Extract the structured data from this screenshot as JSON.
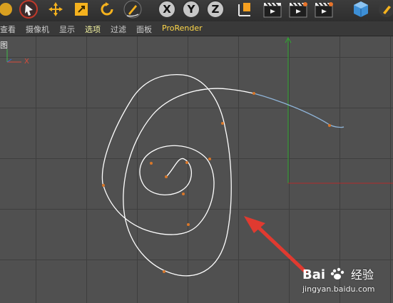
{
  "toolbar": {
    "axis_x_label": "X",
    "axis_y_label": "Y",
    "axis_z_label": "Z"
  },
  "menubar": {
    "items": [
      "查看",
      "摄像机",
      "显示",
      "选项",
      "过滤",
      "面板",
      "ProRender"
    ],
    "active_index": 3
  },
  "viewport": {
    "view_name": "图",
    "axis_label": "X"
  },
  "watermark": {
    "logo": "Bai",
    "logo_tail": "经验",
    "url": "jingyan.baidu.com"
  },
  "colors": {
    "accent_red": "#e03a30",
    "spline_white": "#ffffff",
    "spline_selected": "#8fb4d8",
    "point_orange": "#d9772a",
    "axis_green": "#2fa82f",
    "axis_red": "#b02a2a"
  }
}
